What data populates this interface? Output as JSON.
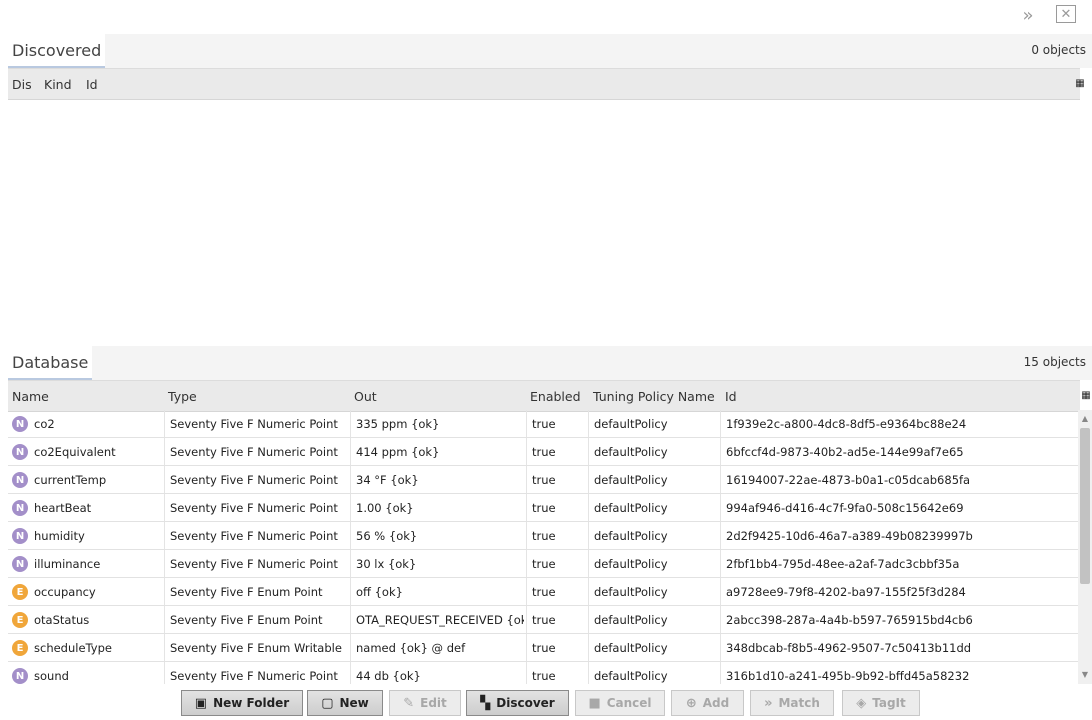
{
  "discovered": {
    "title": "Discovered",
    "count": "0 objects",
    "columns": [
      "Dis",
      "Kind",
      "Id"
    ]
  },
  "database": {
    "title": "Database",
    "count": "15 objects",
    "columns": [
      "Name",
      "Type",
      "Out",
      "Enabled",
      "Tuning Policy Name",
      "Id"
    ],
    "rows": [
      {
        "badge": "N",
        "name": "co2",
        "type": "Seventy Five F Numeric Point",
        "out": "335 ppm {ok}",
        "enabled": "true",
        "policy": "defaultPolicy",
        "id": "1f939e2c-a800-4dc8-8df5-e9364bc88e24"
      },
      {
        "badge": "N",
        "name": "co2Equivalent",
        "type": "Seventy Five F Numeric Point",
        "out": "414 ppm {ok}",
        "enabled": "true",
        "policy": "defaultPolicy",
        "id": "6bfccf4d-9873-40b2-ad5e-144e99af7e65"
      },
      {
        "badge": "N",
        "name": "currentTemp",
        "type": "Seventy Five F Numeric Point",
        "out": "34 °F {ok}",
        "enabled": "true",
        "policy": "defaultPolicy",
        "id": "16194007-22ae-4873-b0a1-c05dcab685fa"
      },
      {
        "badge": "N",
        "name": "heartBeat",
        "type": "Seventy Five F Numeric Point",
        "out": "1.00 {ok}",
        "enabled": "true",
        "policy": "defaultPolicy",
        "id": "994af946-d416-4c7f-9fa0-508c15642e69"
      },
      {
        "badge": "N",
        "name": "humidity",
        "type": "Seventy Five F Numeric Point",
        "out": "56 % {ok}",
        "enabled": "true",
        "policy": "defaultPolicy",
        "id": "2d2f9425-10d6-46a7-a389-49b08239997b"
      },
      {
        "badge": "N",
        "name": "illuminance",
        "type": "Seventy Five F Numeric Point",
        "out": "30 lx {ok}",
        "enabled": "true",
        "policy": "defaultPolicy",
        "id": "2fbf1bb4-795d-48ee-a2af-7adc3cbbf35a"
      },
      {
        "badge": "E",
        "name": "occupancy",
        "type": "Seventy Five F Enum Point",
        "out": "off {ok}",
        "enabled": "true",
        "policy": "defaultPolicy",
        "id": "a9728ee9-79f8-4202-ba97-155f25f3d284"
      },
      {
        "badge": "E",
        "name": "otaStatus",
        "type": "Seventy Five F Enum Point",
        "out": "OTA_REQUEST_RECEIVED {ok}",
        "enabled": "true",
        "policy": "defaultPolicy",
        "id": "2abcc398-287a-4a4b-b597-765915bd4cb6"
      },
      {
        "badge": "E",
        "name": "scheduleType",
        "type": "Seventy Five F Enum Writable",
        "out": "named {ok} @ def",
        "enabled": "true",
        "policy": "defaultPolicy",
        "id": "348dbcab-f8b5-4962-9507-7c50413b11dd"
      },
      {
        "badge": "N",
        "name": "sound",
        "type": "Seventy Five F Numeric Point",
        "out": "44 db {ok}",
        "enabled": "true",
        "policy": "defaultPolicy",
        "id": "316b1d10-a241-495b-9b92-bffd45a58232"
      }
    ]
  },
  "badge_colors": {
    "N": "#a38fc9",
    "E": "#f0a63a"
  },
  "icons": {
    "expand": "double-chevron-right-icon",
    "close": "close-box-icon",
    "column_chooser": "column-chooser-icon"
  },
  "toolbar": {
    "buttons": [
      {
        "label": "New Folder",
        "icon": "folder-icon",
        "enabled": true
      },
      {
        "label": "New",
        "icon": "new-doc-icon",
        "enabled": true
      },
      {
        "label": "Edit",
        "icon": "pencil-icon",
        "enabled": false
      },
      {
        "label": "Discover",
        "icon": "binoculars-icon",
        "enabled": true
      },
      {
        "label": "Cancel",
        "icon": "stop-icon",
        "enabled": false
      },
      {
        "label": "Add",
        "icon": "plus-circle-icon",
        "enabled": false
      },
      {
        "label": "Match",
        "icon": "match-icon",
        "enabled": false
      },
      {
        "label": "TagIt",
        "icon": "tag-icon",
        "enabled": false
      }
    ]
  }
}
